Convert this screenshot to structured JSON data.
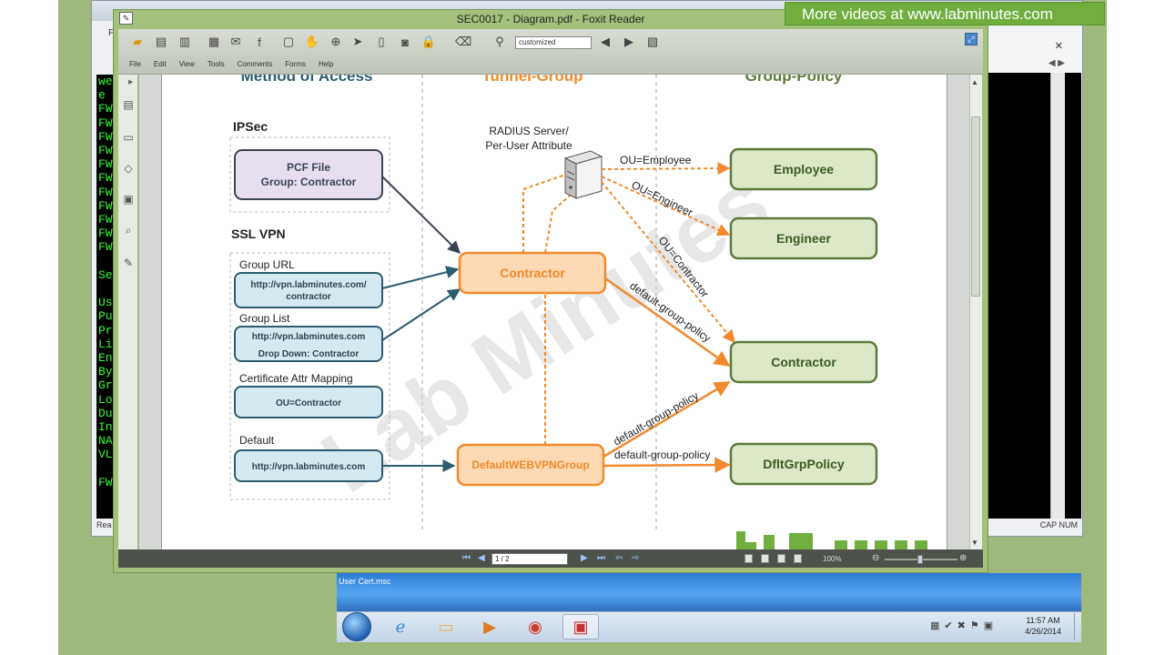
{
  "banner": {
    "text": "More videos at www.labminutes.com"
  },
  "window": {
    "title": "SEC0017 - Diagram.pdf - Foxit Reader"
  },
  "menu": {
    "items": [
      "File",
      "Edit",
      "View",
      "Tools",
      "Comments",
      "Forms",
      "Help"
    ]
  },
  "toolbar": {
    "zoom_value": "customized"
  },
  "status": {
    "page": "1 / 2",
    "zoom": "100%"
  },
  "background_app": {
    "tab_text": "Fi",
    "terminal_lines": [
      "we",
      " e",
      "FW",
      "FW",
      "FW",
      "FW",
      "FW",
      "FW",
      "FW",
      "FW",
      "FW",
      "FW",
      "FW",
      "",
      "Se",
      "",
      "Us",
      "Pu",
      "Pr",
      "Li",
      "En",
      "By",
      "Gr",
      "Lo",
      "Du",
      "In",
      "NA",
      "VL",
      "",
      "FW"
    ],
    "status_left": "Rea",
    "status_right": "CAP  NUM"
  },
  "lower_window": {
    "label": "User Cert.msc"
  },
  "taskbar": {
    "time": "11:57 AM",
    "date": "4/26/2014"
  },
  "diagram": {
    "col_method": "Method of Access",
    "col_tunnel": "Tunnel-Group",
    "col_policy": "Group-Policy",
    "ipsec": "IPSec",
    "pcf_line1": "PCF File",
    "pcf_line2": "Group: Contractor",
    "sslvpn": "SSL VPN",
    "group_url_label": "Group URL",
    "group_url_line1": "http://vpn.labminutes.com/",
    "group_url_line2": "contractor",
    "group_list_label": "Group List",
    "group_list_line1": "http://vpn.labminutes.com",
    "group_list_line2": "Drop Down: Contractor",
    "cert_label": "Certificate Attr Mapping",
    "cert_value": "OU=Contractor",
    "default_label": "Default",
    "default_value": "http://vpn.labminutes.com",
    "radius_line1": "RADIUS Server/",
    "radius_line2": "Per-User Attribute",
    "tg_contractor": "Contractor",
    "tg_default": "DefaultWEBVPNGroup",
    "gp_employee": "Employee",
    "gp_engineer": "Engineer",
    "gp_contractor": "Contractor",
    "gp_dflt": "DfltGrpPolicy",
    "lbl_ou_employee": "OU=Employee",
    "lbl_ou_engineer": "OU=Engineer",
    "lbl_ou_contractor": "OU=Contractor",
    "lbl_dgp": "default-group-policy",
    "watermark": "Lab Minutes"
  },
  "colors": {
    "orange": "#f08a2c",
    "orange_fill": "#fdd9b4",
    "green_stroke": "#5c7a3c",
    "green_fill": "#dce8c8",
    "blue_stroke": "#2d5c6e",
    "blue_fill": "#d5e9f0",
    "purple_fill": "#e7dff0"
  }
}
